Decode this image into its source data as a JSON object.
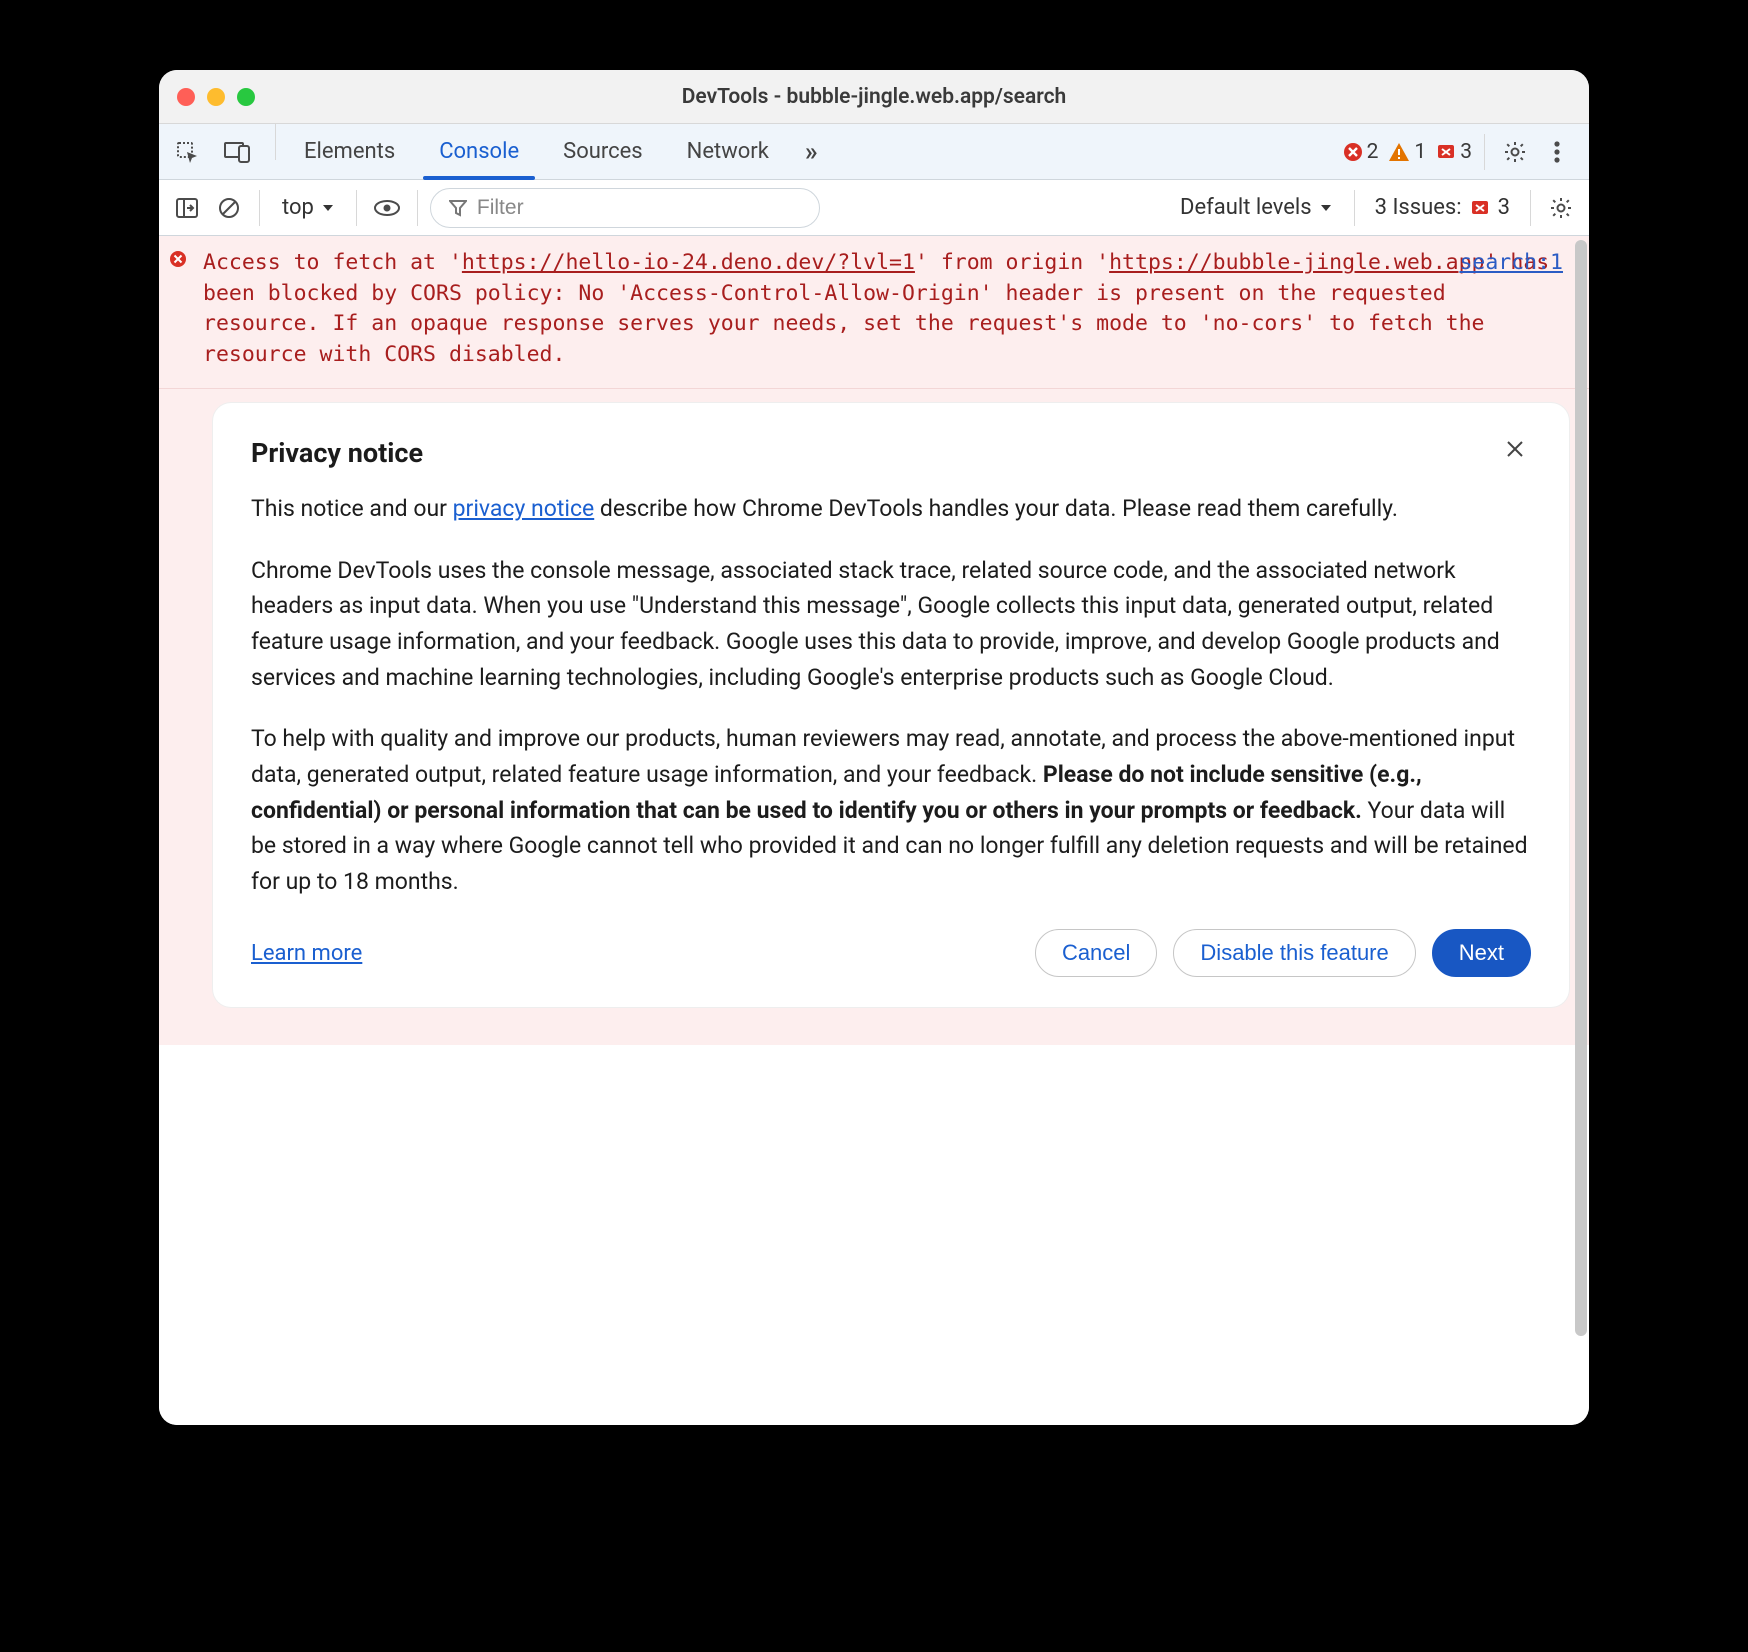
{
  "window": {
    "title": "DevTools - bubble-jingle.web.app/search"
  },
  "tabbar": {
    "tabs": [
      {
        "label": "Elements"
      },
      {
        "label": "Console"
      },
      {
        "label": "Sources"
      },
      {
        "label": "Network"
      }
    ],
    "active_index": 1,
    "more_glyph": "»",
    "badges": {
      "errors": "2",
      "warnings": "1",
      "messages": "3"
    }
  },
  "filterbar": {
    "context": "top",
    "filter_placeholder": "Filter",
    "levels": "Default levels",
    "issues_label": "3 Issues:",
    "issues_count": "3"
  },
  "console_error": {
    "source_link": "search:1",
    "pre_link_text": "Access to fetch at '",
    "url1": "https://hello-io-24.deno.dev/?lvl=1",
    "mid1": "' from origin '",
    "url2": "https://bubble-jingle.web.app",
    "post_text": "' has been blocked by CORS policy: No 'Access-Control-Allow-Origin' header is present on the requested resource. If an opaque response serves your needs, set the request's mode to 'no-cors' to fetch the resource with CORS disabled."
  },
  "privacy": {
    "title": "Privacy notice",
    "p1_a": "This notice and our ",
    "p1_link": "privacy notice",
    "p1_b": " describe how Chrome DevTools handles your data. Please read them carefully.",
    "p2": "Chrome DevTools uses the console message, associated stack trace, related source code, and the associated network headers as input data. When you use \"Understand this message\", Google collects this input data, generated output, related feature usage information, and your feedback. Google uses this data to provide, improve, and develop Google products and services and machine learning technologies, including Google's enterprise products such as Google Cloud.",
    "p3_a": "To help with quality and improve our products, human reviewers may read, annotate, and process the above-mentioned input data, generated output, related feature usage information, and your feedback. ",
    "p3_bold": "Please do not include sensitive (e.g., confidential) or personal information that can be used to identify you or others in your prompts or feedback.",
    "p3_b": " Your data will be stored in a way where Google cannot tell who provided it and can no longer fulfill any deletion requests and will be retained for up to 18 months.",
    "learn_more": "Learn more",
    "cancel": "Cancel",
    "disable": "Disable this feature",
    "next": "Next"
  }
}
